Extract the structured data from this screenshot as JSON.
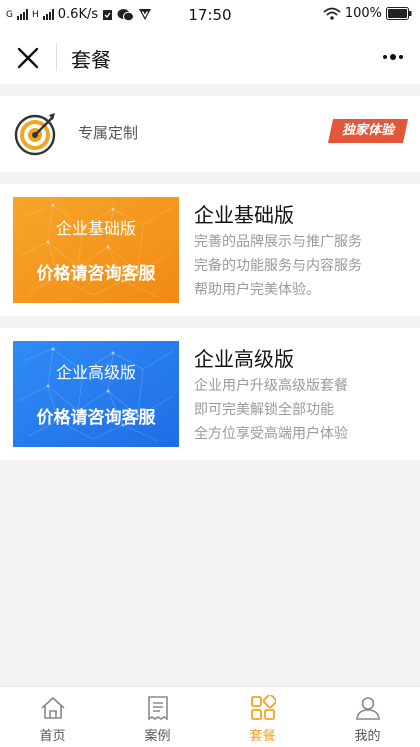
{
  "status_bar": {
    "left_text_1": "G",
    "left_text_2": "H",
    "speed": "0.6K/s",
    "time": "17:50",
    "battery": "100%"
  },
  "header": {
    "title": "套餐",
    "icons": {
      "close": "close-icon",
      "more": "more-dots-icon"
    }
  },
  "promo": {
    "label": "专属定制",
    "badge": "独家体验",
    "icon": "target-dart-icon",
    "badge_color": "#e2563a"
  },
  "plans": [
    {
      "title": "企业基础版",
      "banner_line1": "企业基础版",
      "banner_line2": "价格请咨询客服",
      "banner_color": "#f59a1e",
      "desc": [
        "完善的品牌展示与推广服务",
        "完备的功能服务与内容服务",
        "帮助用户完美体验。"
      ]
    },
    {
      "title": "企业高级版",
      "banner_line1": "企业高级版",
      "banner_line2": "价格请咨询客服",
      "banner_color": "#2b7ff0",
      "desc": [
        "企业用户升级高级版套餐",
        "即可完美解锁全部功能",
        "全方位享受高端用户体验"
      ]
    }
  ],
  "tabbar": {
    "tabs": [
      {
        "label": "首页",
        "icon": "home-icon",
        "active": false
      },
      {
        "label": "案例",
        "icon": "document-icon",
        "active": false
      },
      {
        "label": "套餐",
        "icon": "grid-icon",
        "active": true
      },
      {
        "label": "我的",
        "icon": "user-icon",
        "active": false
      }
    ],
    "active_color": "#f0a31f"
  }
}
